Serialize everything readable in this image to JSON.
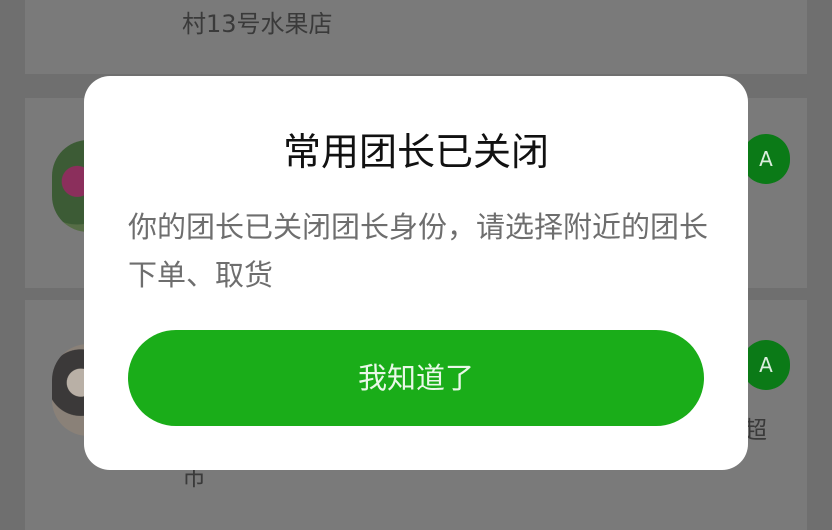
{
  "background": {
    "shop_text": "村13号水果店",
    "button_label": "A",
    "right_text": "超",
    "bottom_text": "市"
  },
  "dialog": {
    "title": "常用团长已关闭",
    "message": "你的团长已关闭团长身份，请选择附近的团长下单、取货",
    "button_label": "我知道了"
  },
  "colors": {
    "overlay": "#6f6f6f",
    "dialog_background": "#ffffff",
    "primary_button": "#1aad19",
    "background_action": "#0b7a17"
  }
}
